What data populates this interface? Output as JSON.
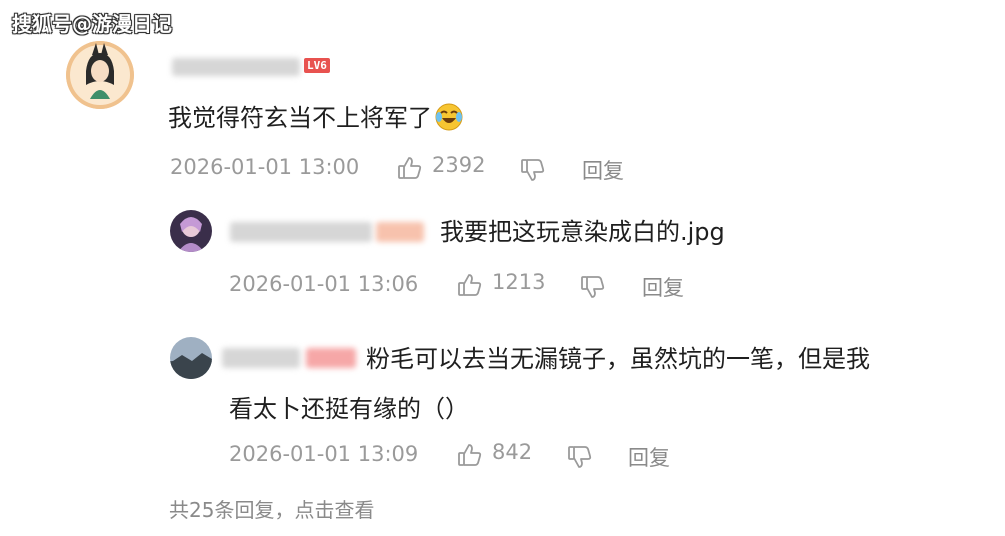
{
  "watermark": "搜狐号@游漫日记",
  "main_comment": {
    "level_badge": "LV6",
    "text": "我觉得符玄当不上将军了",
    "emoji": "laughing-crying-face-icon",
    "timestamp": "2026-01-01 13:00",
    "likes": "2392",
    "reply_label": "回复"
  },
  "replies": [
    {
      "text": "我要把这玩意染成白的.jpg",
      "timestamp": "2026-01-01 13:06",
      "likes": "1213",
      "reply_label": "回复"
    },
    {
      "text_line1": "粉毛可以去当无漏镜子，虽然坑的一笔，但是我",
      "text_line2": "看太卜还挺有缘的（）",
      "timestamp": "2026-01-01 13:09",
      "likes": "842",
      "reply_label": "回复"
    }
  ],
  "more_replies": "共25条回复，点击查看",
  "colors": {
    "meta_gray": "#9a9a9a",
    "badge_red": "#e8524f"
  }
}
